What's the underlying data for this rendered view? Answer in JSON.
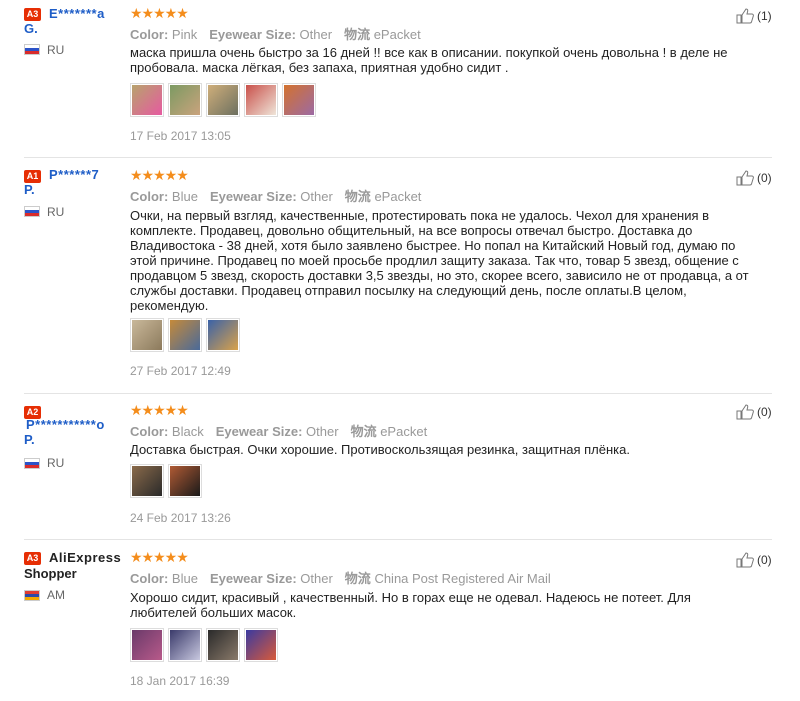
{
  "reviews": [
    {
      "badge": "A3",
      "name_line1": "E*******a",
      "name_line2": "G.",
      "country": "RU",
      "flag": "ru",
      "stars": "★★★★★",
      "attr_color_label": "Color:",
      "attr_color_value": "Pink",
      "attr_size_label": "Eyewear Size:",
      "attr_size_value": "Other",
      "attr_ship_label": "物流",
      "attr_ship_value": "ePacket",
      "text": "маска пришла очень быстро за 16 дней !! все как в описании. покупкой очень довольна ! в деле не пробовала. маска лёгкая, без запаха, приятная удобно сидит .",
      "thumb_colors": [
        [
          "#b7a36c",
          "#e65aa0"
        ],
        [
          "#7c9a62",
          "#caa37d"
        ],
        [
          "#cfae7a",
          "#6d7060"
        ],
        [
          "#c9504a",
          "#efe5d9"
        ],
        [
          "#d3722e",
          "#9c6aa4"
        ]
      ],
      "date": "17 Feb 2017 13:05",
      "helpful": "(1)"
    },
    {
      "badge": "A1",
      "name_line1": "P******7",
      "name_line2": "P.",
      "country": "RU",
      "flag": "ru",
      "stars": "★★★★★",
      "attr_color_label": "Color:",
      "attr_color_value": "Blue",
      "attr_size_label": "Eyewear Size:",
      "attr_size_value": "Other",
      "attr_ship_label": "物流",
      "attr_ship_value": "ePacket",
      "text": "Очки, на первый взгляд, качественные, протестировать пока не удалось. Чехол для хранения в комплекте. Продавец, довольно общительный, на все вопросы отвечал быстро. Доставка до Владивостока - 38 дней, хотя было заявлено быстрее. Но попал на Китайский Новый год, думаю по этой причине. Продавец по моей просьбе продлил защиту заказа. Так что, товар 5 звезд, общение с продавцом 5 звезд, скорость доставки 3,5 звезды, но это, скорее всего, зависило не от продавца, а от службы доставки. Продавец отправил посылку на следующий день, после оплаты.В целом, рекомендую.",
      "thumb_colors": [
        [
          "#c9b89a",
          "#8c7a5c"
        ],
        [
          "#c58a3a",
          "#4a6a9a"
        ],
        [
          "#3a62a8",
          "#d9a24a"
        ]
      ],
      "date": "27 Feb 2017 12:49",
      "helpful": "(0)"
    },
    {
      "badge": "A2",
      "name_line1": "P***********o",
      "name_line2": "P.",
      "country": "RU",
      "flag": "ru",
      "stars": "★★★★★",
      "attr_color_label": "Color:",
      "attr_color_value": "Black",
      "attr_size_label": "Eyewear Size:",
      "attr_size_value": "Other",
      "attr_ship_label": "物流",
      "attr_ship_value": "ePacket",
      "text": "Доставка быстрая. Очки хорошие. Противоскользящая резинка, защитная плёнка.",
      "thumb_colors": [
        [
          "#8a6a4a",
          "#2a2a2a"
        ],
        [
          "#b05a34",
          "#1a1a1a"
        ]
      ],
      "date": "24 Feb 2017 13:26",
      "helpful": "(0)"
    },
    {
      "badge": "A3",
      "name_line1": "AliExpress",
      "name_line2": "Shopper",
      "country": "AM",
      "flag": "am",
      "stars": "★★★★★",
      "attr_color_label": "Color:",
      "attr_color_value": "Blue",
      "attr_size_label": "Eyewear Size:",
      "attr_size_value": "Other",
      "attr_ship_label": "物流",
      "attr_ship_value": "China Post Registered Air Mail",
      "text": "Хорошо сидит, красивый , качественный. Но в горах еще не одевал. Надеюсь не потеет. Для любителей больших масок.",
      "thumb_colors": [
        [
          "#6a3a6a",
          "#b85a8a"
        ],
        [
          "#3a3a6a",
          "#c8c8e0"
        ],
        [
          "#2a2a2a",
          "#8a7a6a"
        ],
        [
          "#3a3aa0",
          "#d85a3a"
        ]
      ],
      "date": "18 Jan 2017 16:39",
      "helpful": "(0)"
    }
  ]
}
